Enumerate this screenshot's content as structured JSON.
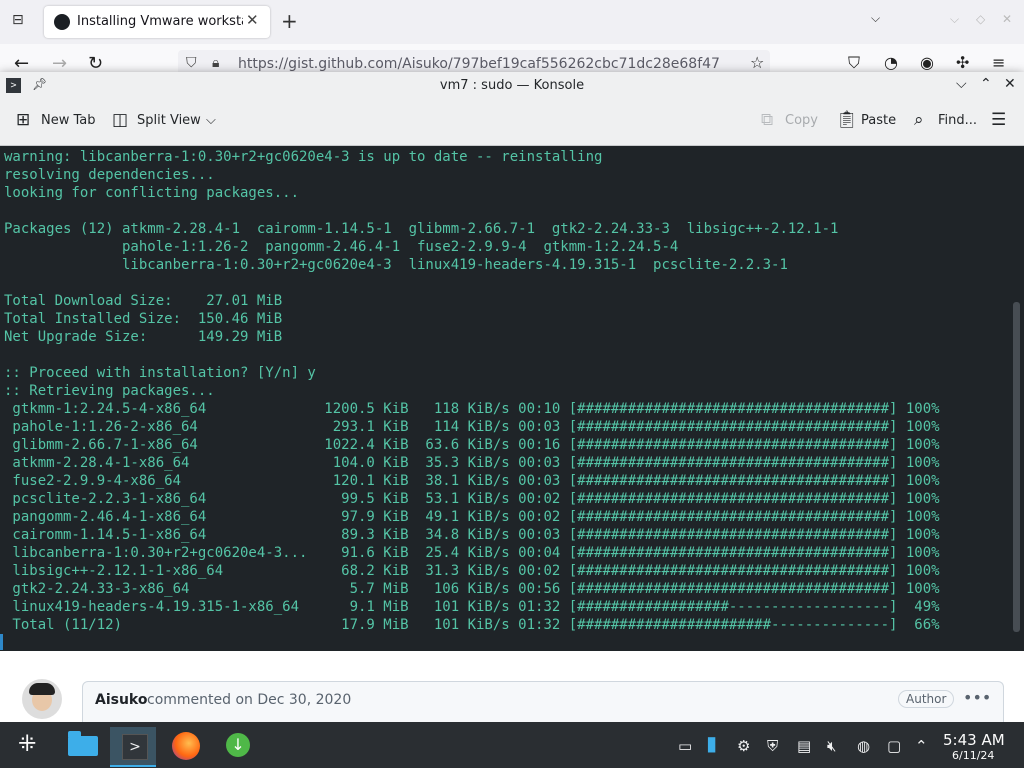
{
  "browser": {
    "tab_title": "Installing Vmware workstat",
    "url": "https://gist.github.com/Aisuko/797bef19caf556262cbc71dc28e68f47"
  },
  "konsole": {
    "title": "vm7 : sudo — Konsole",
    "toolbar": {
      "new_tab": "New Tab",
      "split_view": "Split View",
      "copy": "Copy",
      "paste": "Paste",
      "find": "Find..."
    },
    "terminal_lines": [
      "warning: libcanberra-1:0.30+r2+gc0620e4-3 is up to date -- reinstalling",
      "resolving dependencies...",
      "looking for conflicting packages...",
      "",
      "Packages (12) atkmm-2.28.4-1  cairomm-1.14.5-1  glibmm-2.66.7-1  gtk2-2.24.33-3  libsigc++-2.12.1-1",
      "              pahole-1:1.26-2  pangomm-2.46.4-1  fuse2-2.9.9-4  gtkmm-1:2.24.5-4",
      "              libcanberra-1:0.30+r2+gc0620e4-3  linux419-headers-4.19.315-1  pcsclite-2.2.3-1",
      "",
      "Total Download Size:    27.01 MiB",
      "Total Installed Size:  150.46 MiB",
      "Net Upgrade Size:      149.29 MiB",
      "",
      ":: Proceed with installation? [Y/n] y",
      ":: Retrieving packages...",
      " gtkmm-1:2.24.5-4-x86_64              1200.5 KiB   118 KiB/s 00:10 [#####################################] 100%",
      " pahole-1:1.26-2-x86_64                293.1 KiB   114 KiB/s 00:03 [#####################################] 100%",
      " glibmm-2.66.7-1-x86_64               1022.4 KiB  63.6 KiB/s 00:16 [#####################################] 100%",
      " atkmm-2.28.4-1-x86_64                 104.0 KiB  35.3 KiB/s 00:03 [#####################################] 100%",
      " fuse2-2.9.9-4-x86_64                  120.1 KiB  38.1 KiB/s 00:03 [#####################################] 100%",
      " pcsclite-2.2.3-1-x86_64                99.5 KiB  53.1 KiB/s 00:02 [#####################################] 100%",
      " pangomm-2.46.4-1-x86_64                97.9 KiB  49.1 KiB/s 00:02 [#####################################] 100%",
      " cairomm-1.14.5-1-x86_64                89.3 KiB  34.8 KiB/s 00:03 [#####################################] 100%",
      " libcanberra-1:0.30+r2+gc0620e4-3...    91.6 KiB  25.4 KiB/s 00:04 [#####################################] 100%",
      " libsigc++-2.12.1-1-x86_64              68.2 KiB  31.3 KiB/s 00:02 [#####################################] 100%",
      " gtk2-2.24.33-3-x86_64                   5.7 MiB   106 KiB/s 00:56 [#####################################] 100%",
      " linux419-headers-4.19.315-1-x86_64      9.1 MiB   101 KiB/s 01:32 [##################-------------------]  49%",
      " Total (11/12)                          17.9 MiB   101 KiB/s 01:32 [#######################--------------]  66%"
    ]
  },
  "github": {
    "comment_author": "Aisuko",
    "comment_meta": "commented on Dec 30, 2020",
    "badge": "Author",
    "more": "•••"
  },
  "taskbar": {
    "time": "5:43 AM",
    "date": "6/11/24"
  },
  "colors": {
    "terminal_bg": "#1f2428",
    "terminal_fg": "#54c4a6",
    "taskbar_bg": "#2a2e32"
  }
}
